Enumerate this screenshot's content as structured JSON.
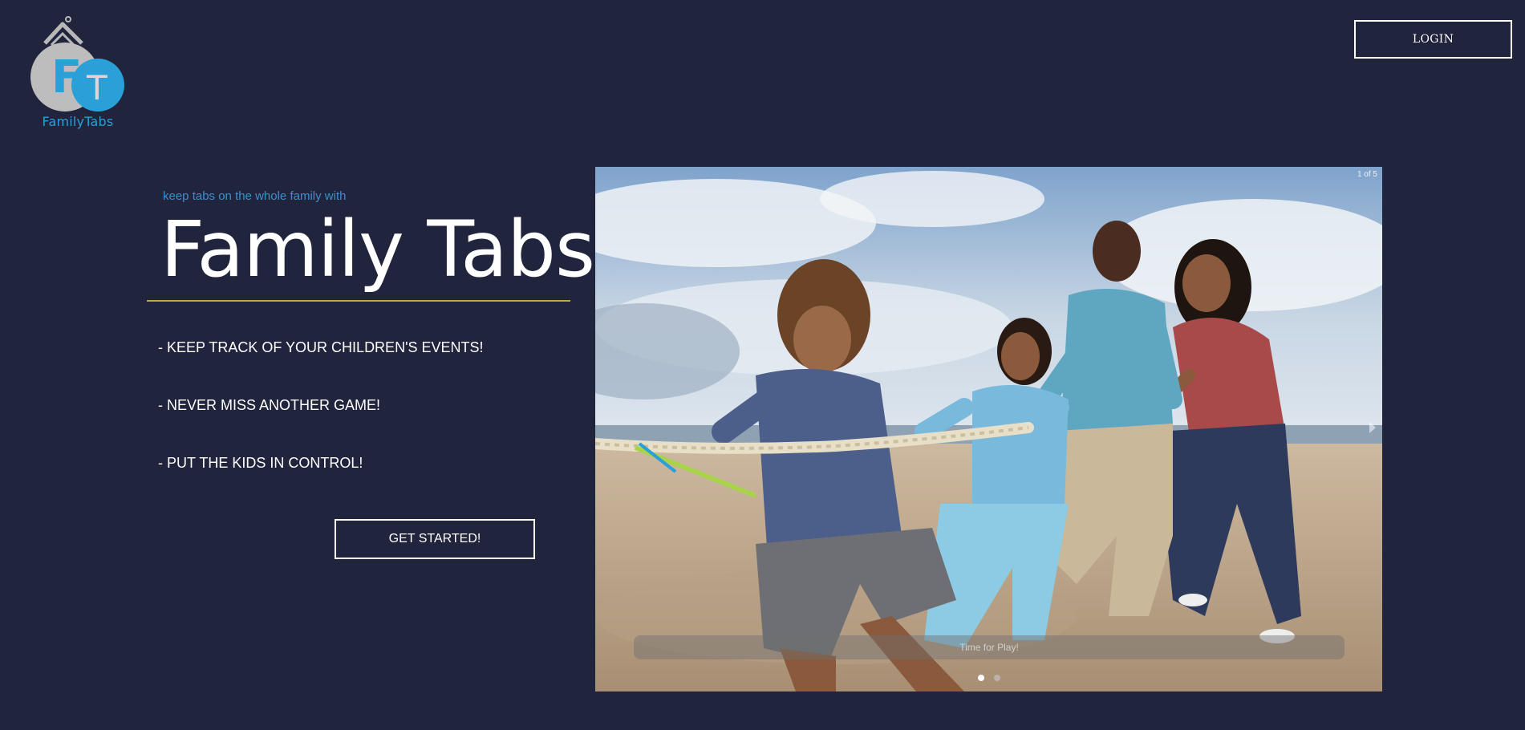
{
  "header": {
    "logo_text": "FamilyTabs",
    "logo_letters": [
      "F",
      "T"
    ],
    "login_label": "LOGIN"
  },
  "hero": {
    "tagline": "keep tabs on the whole family with",
    "headline": "Family Tabs",
    "features": [
      "- KEEP TRACK OF YOUR CHILDREN'S EVENTS!",
      "- NEVER MISS ANOTHER GAME!",
      "- PUT THE KIDS IN CONTROL!"
    ],
    "cta_label": "GET STARTED!"
  },
  "slideshow": {
    "counter": "1 of 5",
    "caption": "Time for Play!",
    "total_dots": 2,
    "active_dot": 1
  },
  "colors": {
    "background": "#20243d",
    "accent_blue": "#2a9fd8",
    "divider_gold": "#c9a24a"
  }
}
